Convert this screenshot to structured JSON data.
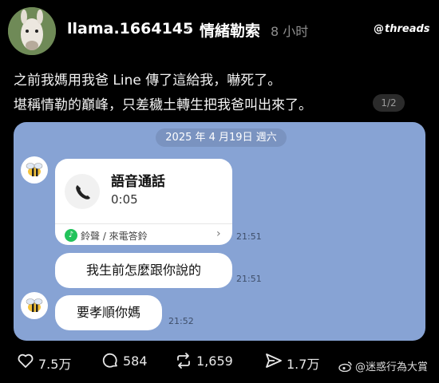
{
  "header": {
    "username": "llama.1664145",
    "chevron": "›",
    "topic": "情緒勒索",
    "time_ago": "8 小时",
    "brand": "threads",
    "brand_mark": "@"
  },
  "post": {
    "line1": "之前我媽用我爸 Line 傳了這給我，嚇死了。",
    "line2": "堪稱情勒的巔峰，只差穢土轉生把我爸叫出來了。",
    "page_indicator": "1/2"
  },
  "chat": {
    "date": "2025 年 4 月19日 週六",
    "call": {
      "title": "語音通話",
      "duration": "0:05",
      "ringtone_label": "鈴聲 / 來電答鈴",
      "time": "21:51"
    },
    "messages": [
      {
        "text": "我生前怎麼跟你說的",
        "time": "21:51"
      },
      {
        "text": "要孝順你媽",
        "time": "21:52"
      }
    ]
  },
  "actions": {
    "likes": "7.5万",
    "comments": "584",
    "reposts": "1,659",
    "shares": "1.7万"
  },
  "watermark": "@迷惑行為大賞",
  "colors": {
    "background": "#000000",
    "chat_background": "#87a3d4",
    "bubble": "#ffffff",
    "muted_text": "#8e8e8e"
  }
}
